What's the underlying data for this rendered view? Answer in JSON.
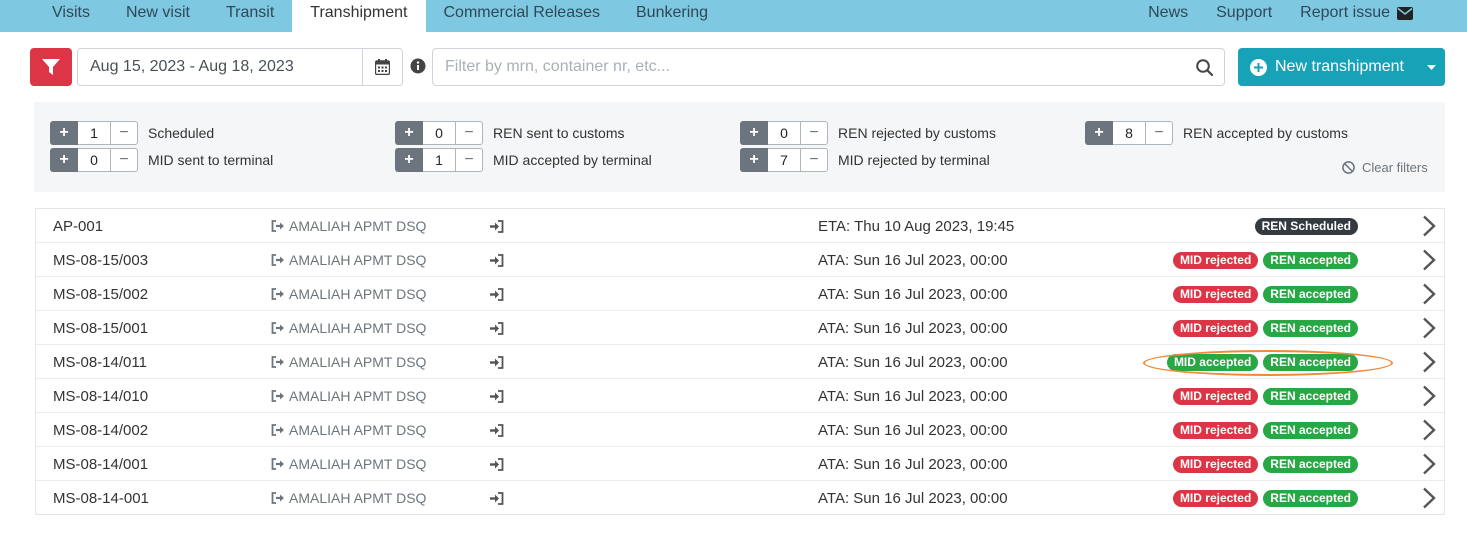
{
  "nav": {
    "tabs": [
      {
        "label": "Visits",
        "active": false
      },
      {
        "label": "New visit",
        "active": false
      },
      {
        "label": "Transit",
        "active": false
      },
      {
        "label": "Transhipment",
        "active": true
      },
      {
        "label": "Commercial Releases",
        "active": false
      },
      {
        "label": "Bunkering",
        "active": false
      }
    ],
    "right": {
      "news": "News",
      "support": "Support",
      "report": "Report issue"
    }
  },
  "filter": {
    "date_range": "Aug 15, 2023 - Aug 18, 2023",
    "search_placeholder": "Filter by mrn, container nr, etc...",
    "new_button": "New transhipment"
  },
  "counters": [
    {
      "value": "1",
      "label": "Scheduled"
    },
    {
      "value": "0",
      "label": "MID sent to terminal"
    },
    {
      "value": "0",
      "label": "REN sent to customs"
    },
    {
      "value": "1",
      "label": "MID accepted by terminal"
    },
    {
      "value": "0",
      "label": "REN rejected by customs"
    },
    {
      "value": "7",
      "label": "MID rejected by terminal"
    },
    {
      "value": "8",
      "label": "REN accepted by customs"
    }
  ],
  "clear_filters": "Clear filters",
  "rows": [
    {
      "id": "AP-001",
      "terminal": "AMALIAH APMT DSQ",
      "time": "ETA: Thu 10 Aug 2023, 19:45",
      "badges": [
        {
          "text": "REN Scheduled",
          "kind": "dark"
        }
      ]
    },
    {
      "id": "MS-08-15/003",
      "terminal": "AMALIAH APMT DSQ",
      "time": "ATA: Sun 16 Jul 2023, 00:00",
      "badges": [
        {
          "text": "MID rejected",
          "kind": "danger"
        },
        {
          "text": "REN accepted",
          "kind": "success"
        }
      ]
    },
    {
      "id": "MS-08-15/002",
      "terminal": "AMALIAH APMT DSQ",
      "time": "ATA: Sun 16 Jul 2023, 00:00",
      "badges": [
        {
          "text": "MID rejected",
          "kind": "danger"
        },
        {
          "text": "REN accepted",
          "kind": "success"
        }
      ]
    },
    {
      "id": "MS-08-15/001",
      "terminal": "AMALIAH APMT DSQ",
      "time": "ATA: Sun 16 Jul 2023, 00:00",
      "badges": [
        {
          "text": "MID rejected",
          "kind": "danger"
        },
        {
          "text": "REN accepted",
          "kind": "success"
        }
      ]
    },
    {
      "id": "MS-08-14/011",
      "terminal": "AMALIAH APMT DSQ",
      "time": "ATA: Sun 16 Jul 2023, 00:00",
      "badges": [
        {
          "text": "MID accepted",
          "kind": "success"
        },
        {
          "text": "REN accepted",
          "kind": "success"
        }
      ]
    },
    {
      "id": "MS-08-14/010",
      "terminal": "AMALIAH APMT DSQ",
      "time": "ATA: Sun 16 Jul 2023, 00:00",
      "badges": [
        {
          "text": "MID rejected",
          "kind": "danger"
        },
        {
          "text": "REN accepted",
          "kind": "success"
        }
      ]
    },
    {
      "id": "MS-08-14/002",
      "terminal": "AMALIAH APMT DSQ",
      "time": "ATA: Sun 16 Jul 2023, 00:00",
      "badges": [
        {
          "text": "MID rejected",
          "kind": "danger"
        },
        {
          "text": "REN accepted",
          "kind": "success"
        }
      ]
    },
    {
      "id": "MS-08-14/001",
      "terminal": "AMALIAH APMT DSQ",
      "time": "ATA: Sun 16 Jul 2023, 00:00",
      "badges": [
        {
          "text": "MID rejected",
          "kind": "danger"
        },
        {
          "text": "REN accepted",
          "kind": "success"
        }
      ]
    },
    {
      "id": "MS-08-14-001",
      "terminal": "AMALIAH APMT DSQ",
      "time": "ATA: Sun 16 Jul 2023, 00:00",
      "badges": [
        {
          "text": "MID rejected",
          "kind": "danger"
        },
        {
          "text": "REN accepted",
          "kind": "success"
        }
      ]
    }
  ],
  "colors": {
    "navbar": "#7ec8e1",
    "danger": "#dc3545",
    "success": "#28a745",
    "info": "#17a2b8",
    "dark": "#343a40",
    "highlight": "#ef8a3c"
  },
  "icons": {
    "filter": "filter-icon",
    "calendar": "calendar-icon",
    "info": "info-circle-icon",
    "search": "search-icon",
    "new": "plus-circle-icon",
    "terminal": "sign-out-icon",
    "enter": "sign-in-icon",
    "row_action": "chevron-right-icon",
    "clear": "ban-icon",
    "mail": "envelope-icon"
  }
}
